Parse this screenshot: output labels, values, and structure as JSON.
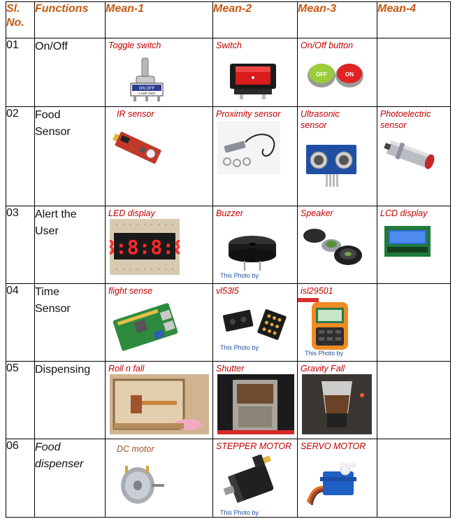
{
  "header": {
    "sl": "Sl. No.",
    "sl_line1": "Sl.",
    "sl_line2": "No.",
    "functions": "Functions",
    "mean1": "Mean-1",
    "mean2": "Mean-2",
    "mean3": "Mean-3",
    "mean4": "Mean-4"
  },
  "rows": [
    {
      "sl": "01",
      "function": "On/Off",
      "mean1": "Toggle switch",
      "mean2": "Switch",
      "mean3": "On/Off button",
      "mean4": ""
    },
    {
      "sl": "02",
      "function": "Food Sensor",
      "function_line1": "Food",
      "function_line2": "Sensor",
      "mean1": "IR sensor",
      "mean2": "Proximity sensor",
      "mean3": "Ultrasonic sensor",
      "mean4": "Photoelectric sensor"
    },
    {
      "sl": "03",
      "function": "Alert the User",
      "function_line1": "Alert the",
      "function_line2": "User",
      "mean1": "LED display",
      "mean2": "Buzzer",
      "mean3": "Speaker",
      "mean4": "LCD display"
    },
    {
      "sl": "04",
      "function": "Time Sensor",
      "function_line1": "Time",
      "function_line2": "Sensor",
      "mean1": "flight sense",
      "mean2": "vl53l5",
      "mean3": "isl29501",
      "mean4": ""
    },
    {
      "sl": "05",
      "function": "Dispensing",
      "mean1": "Roll n fall",
      "mean2": "Shutter",
      "mean3": "Gravity Fall",
      "mean4": ""
    },
    {
      "sl": "06",
      "function": "Food dispenser",
      "function_line1": "Food",
      "function_line2": "dispenser",
      "mean1": "DC motor",
      "mean2": "STEPPER MOTOR",
      "mean3": "SERVO MOTOR",
      "mean4": ""
    }
  ],
  "images": {
    "toggle_switch_text": "ON OFF",
    "toggle_switch_sub": "4 AMP 250V",
    "off_button": "OFF",
    "on_button": "ON",
    "led_digits": "8:8:8:8",
    "photo_credit": "This Photo by"
  }
}
